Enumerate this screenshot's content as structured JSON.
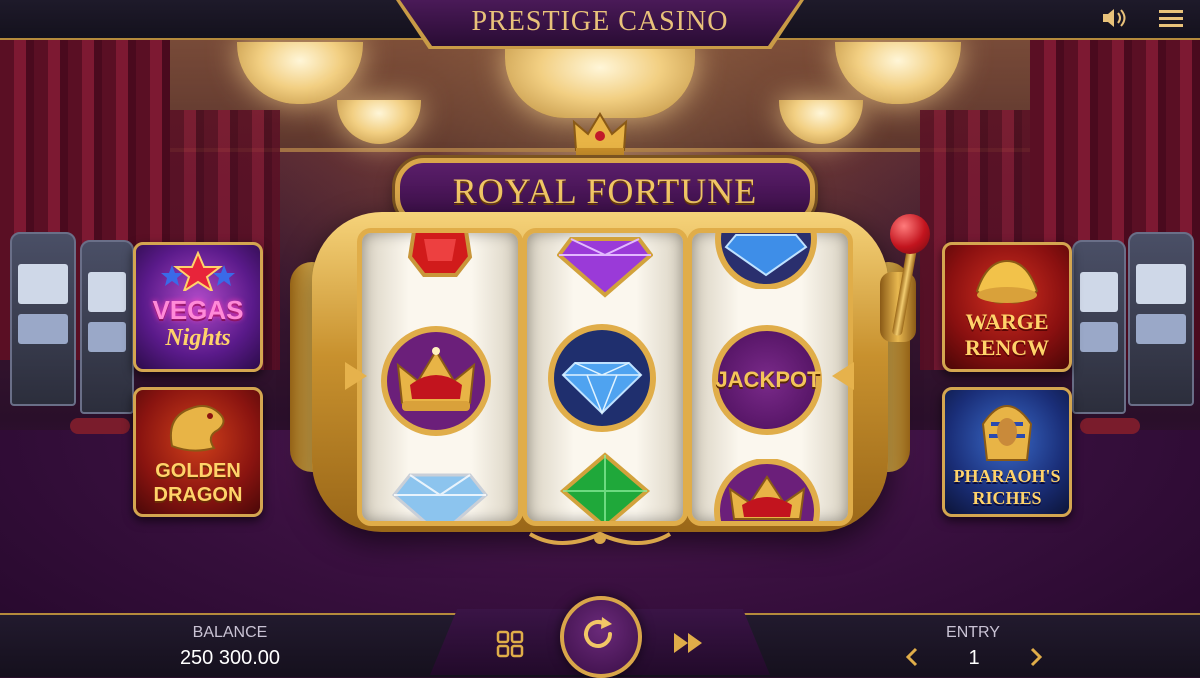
{
  "header": {
    "title": "PRESTIGE CASINO",
    "sound_icon": "speaker-icon",
    "menu_icon": "hamburger-menu-icon"
  },
  "machine": {
    "title": "ROYAL FORTUNE",
    "reels": [
      [
        "ruby",
        "crown",
        "blue-diamond"
      ],
      [
        "amethyst",
        "blue-diamond",
        "emerald"
      ],
      [
        "blue-diamond",
        "jackpot",
        "crown"
      ]
    ],
    "jackpot_label": "JACKPOT"
  },
  "games": {
    "left": [
      {
        "id": "vegas-nights",
        "line1": "VEGAS",
        "line2": "Nights"
      },
      {
        "id": "golden-dragon",
        "line1": "GOLDEN",
        "line2": "DRAGON"
      }
    ],
    "right": [
      {
        "id": "warge-rencw",
        "line1": "WARGE",
        "line2": "RENCW"
      },
      {
        "id": "pharaohs-riches",
        "line1": "PHARAOH'S",
        "line2": "RICHES"
      }
    ]
  },
  "footer": {
    "balance_label": "BALANCE",
    "balance_value": "250 300.00",
    "entry_label": "ENTRY",
    "entry_value": "1",
    "grid_icon": "grid-icon",
    "spin_icon": "spin-refresh-icon",
    "fast_forward_icon": "fast-forward-icon",
    "decrease_icon": "chevron-left-icon",
    "increase_icon": "chevron-right-icon"
  },
  "colors": {
    "gold": "#d9a64a",
    "purple": "#4a1a58",
    "background": "#2a0f2c"
  }
}
